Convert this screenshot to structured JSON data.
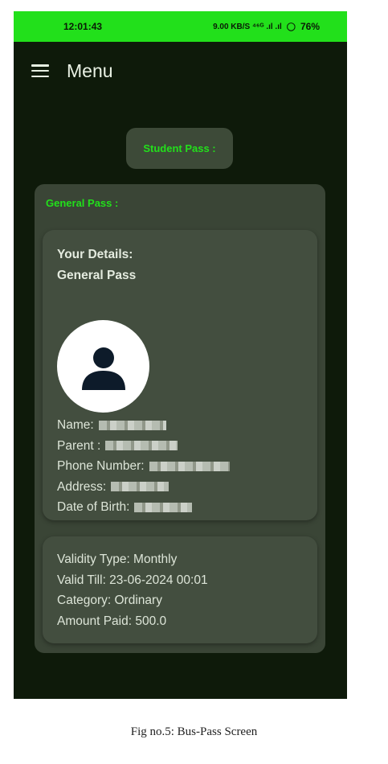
{
  "status_bar": {
    "time": "12:01:43",
    "indicators": "9.00 KB/S  ⁴⁶ᴳ .ıl .ıl",
    "battery": "76%"
  },
  "app_bar": {
    "title": "Menu",
    "menu_icon": "hamburger-icon"
  },
  "student_pass_button": "Student Pass :",
  "general_pass": {
    "title": "General Pass :",
    "details": {
      "heading_line1": "Your Details:",
      "heading_line2": "General Pass",
      "avatar_icon": "person-icon",
      "fields": {
        "name_label": "Name:",
        "parent_label": "Parent :",
        "phone_label": "Phone Number:",
        "address_label": "Address:",
        "dob_label": "Date of Birth:"
      }
    },
    "validity": {
      "type": "Validity Type: Monthly",
      "valid_till": "Valid Till: 23-06-2024 00:01",
      "category": "Category: Ordinary",
      "amount": "Amount Paid: 500.0"
    }
  },
  "caption": "Fig no.5: Bus-Pass Screen",
  "colors": {
    "accent_green": "#22e01b",
    "background": "#0e1a0a",
    "card": "#3a4536"
  }
}
